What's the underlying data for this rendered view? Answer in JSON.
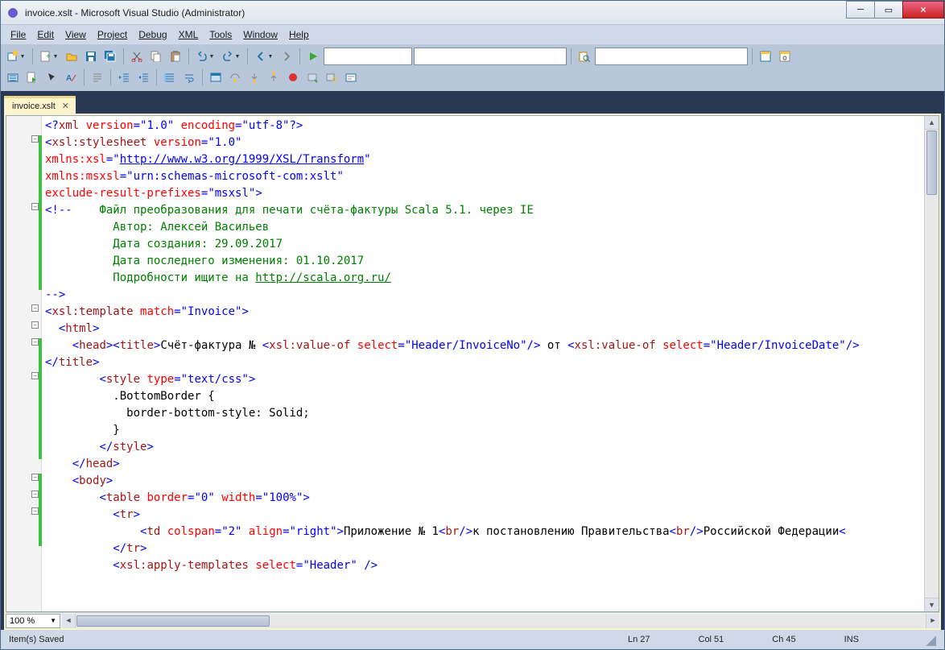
{
  "window": {
    "title": "invoice.xslt - Microsoft Visual Studio (Administrator)"
  },
  "menu": {
    "file": "File",
    "edit": "Edit",
    "view": "View",
    "project": "Project",
    "debug": "Debug",
    "xml": "XML",
    "tools": "Tools",
    "window": "Window",
    "help": "Help"
  },
  "tab": {
    "name": "invoice.xslt"
  },
  "zoom": {
    "value": "100 %"
  },
  "status": {
    "message": "Item(s) Saved",
    "line": "Ln 27",
    "col": "Col 51",
    "ch": "Ch 45",
    "ins": "INS"
  },
  "code": {
    "l1_a": "<?",
    "l1_b": "xml",
    "l1_c": " version",
    "l1_d": "=",
    "l1_e": "\"1.0\"",
    "l1_f": " encoding",
    "l1_g": "=",
    "l1_h": "\"utf-8\"",
    "l1_i": "?>",
    "l2_a": "<",
    "l2_b": "xsl:stylesheet",
    "l2_c": " version",
    "l2_d": "=",
    "l2_e": "\"1.0\"",
    "l3_a": "xmlns:xsl",
    "l3_b": "=",
    "l3_c": "\"",
    "l3_link": "http://www.w3.org/1999/XSL/Transform",
    "l3_d": "\"",
    "l4_a": "xmlns:msxsl",
    "l4_b": "=",
    "l4_c": "\"urn:schemas-microsoft-com:xslt\"",
    "l5_a": "exclude-result-prefixes",
    "l5_b": "=",
    "l5_c": "\"msxsl\"",
    "l5_d": ">",
    "l6_a": "<!--",
    "l6_b": "    Файл преобразования для печати счёта-фактуры Scala 5.1. через IE",
    "l7": "          Автор: Алексей Васильев",
    "l8": "          Дата создания: 29.09.2017",
    "l9": "          Дата последнего изменения: 01.10.2017",
    "l10_a": "          Подробности ищите на ",
    "l10_link": "http://scala.org.ru/",
    "l11": "-->",
    "l12_a": "<",
    "l12_b": "xsl:template",
    "l12_c": " match",
    "l12_d": "=",
    "l12_e": "\"Invoice\"",
    "l12_f": ">",
    "l13_a": "<",
    "l13_b": "html",
    "l13_c": ">",
    "l14_a": "<",
    "l14_b": "head",
    "l14_c": "><",
    "l14_d": "title",
    "l14_e": ">",
    "l14_f": "Счёт-фактура № ",
    "l14_g": "<",
    "l14_h": "xsl:value-of",
    "l14_i": " select",
    "l14_j": "=",
    "l14_k": "\"Header/InvoiceNo\"",
    "l14_l": "/>",
    "l14_m": " от ",
    "l14_n": "<",
    "l14_o": "xsl:value-of",
    "l14_p": " select",
    "l14_q": "=",
    "l14_r": "\"Header/InvoiceDate\"",
    "l14_s": "/>",
    "l15_a": "</",
    "l15_b": "title",
    "l15_c": ">",
    "l16_a": "<",
    "l16_b": "style",
    "l16_c": " type",
    "l16_d": "=",
    "l16_e": "\"text/css\"",
    "l16_f": ">",
    "l17": "          .BottomBorder {",
    "l18": "            border-bottom-style: Solid;",
    "l19": "          }",
    "l20_a": "</",
    "l20_b": "style",
    "l20_c": ">",
    "l21_a": "</",
    "l21_b": "head",
    "l21_c": ">",
    "l22_a": "<",
    "l22_b": "body",
    "l22_c": ">",
    "l23_a": "<",
    "l23_b": "table",
    "l23_c": " border",
    "l23_d": "=",
    "l23_e": "\"0\"",
    "l23_f": " width",
    "l23_g": "=",
    "l23_h": "\"100%\"",
    "l23_i": ">",
    "l24_a": "<",
    "l24_b": "tr",
    "l24_c": ">",
    "l25_a": "<",
    "l25_b": "td",
    "l25_c": " colspan",
    "l25_d": "=",
    "l25_e": "\"2\"",
    "l25_f": " align",
    "l25_g": "=",
    "l25_h": "\"right\"",
    "l25_i": ">",
    "l25_j": "Приложение № 1",
    "l25_k": "<",
    "l25_l": "br",
    "l25_m": "/>",
    "l25_n": "к постановлению Правительства",
    "l25_o": "<",
    "l25_p": "br",
    "l25_q": "/>",
    "l25_r": "Российской Федерации",
    "l25_s": "<",
    "l26_a": "</",
    "l26_b": "tr",
    "l26_c": ">",
    "l27_a": "<",
    "l27_b": "xsl:apply-templates",
    "l27_c": " select",
    "l27_d": "=",
    "l27_e": "\"Header\"",
    "l27_f": " />"
  }
}
